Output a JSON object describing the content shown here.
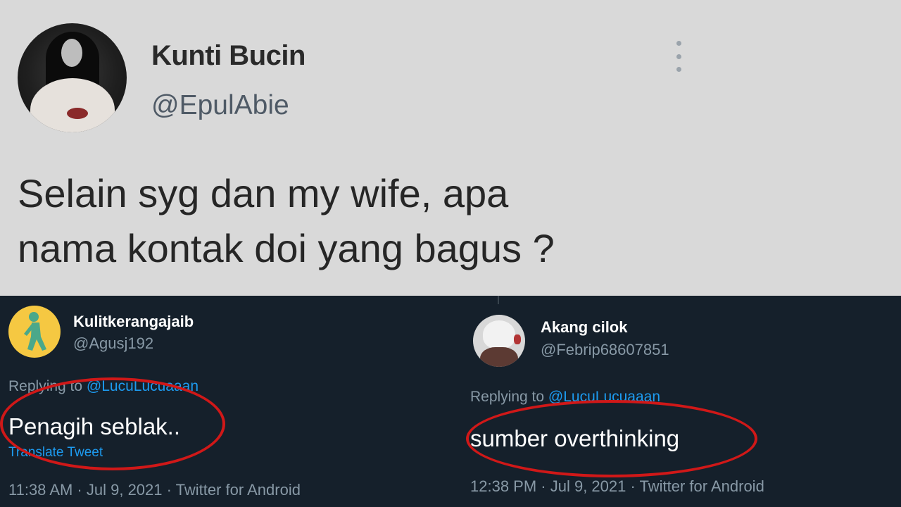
{
  "main_tweet": {
    "author_name": "Kunti Bucin",
    "author_handle": "@EpulAbie",
    "text_line1": "Selain syg dan my wife, apa",
    "text_line2": "nama kontak doi yang bagus ?"
  },
  "replies": [
    {
      "author_name": "Kulitkerangajaib",
      "author_handle": "@Agusj192",
      "replying_prefix": "Replying to ",
      "replying_mention": "@LucuLucuaaan",
      "text": "Penagih seblak..",
      "translate_label": "Translate Tweet",
      "meta": "11:38 AM · Jul 9, 2021 · Twitter for Android"
    },
    {
      "author_name": "Akang cilok",
      "author_handle": "@Febrip68607851",
      "replying_prefix": "Replying to ",
      "replying_mention": "@LucuLucuaaan",
      "text": "sumber overthinking",
      "meta": "12:38 PM · Jul 9, 2021 · Twitter for Android"
    }
  ],
  "colors": {
    "top_background": "#d9d9d9",
    "dark_background": "#15202b",
    "highlight": "#d01818",
    "link": "#1d9bf0"
  },
  "icons": {
    "more": "more-vertical-icon"
  }
}
